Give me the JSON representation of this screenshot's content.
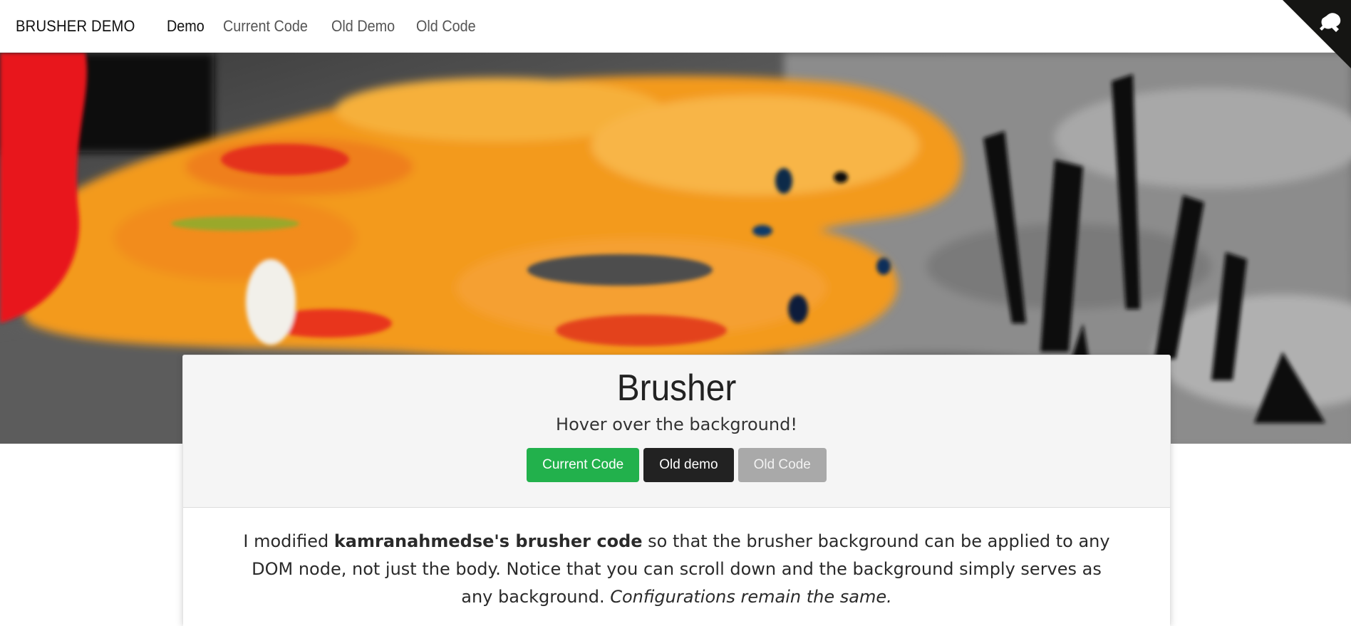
{
  "nav": {
    "brand": "BRUSHER DEMO",
    "links": [
      {
        "label": "Demo",
        "active": true
      },
      {
        "label": "Current Code",
        "active": false
      },
      {
        "label": "Old Demo",
        "active": false
      },
      {
        "label": "Old Code",
        "active": false
      }
    ]
  },
  "hero": {
    "title": "Brusher",
    "subtitle": "Hover over the background!",
    "buttons": [
      {
        "label": "Current Code",
        "color": "#22b14c"
      },
      {
        "label": "Old demo",
        "color": "#222222"
      },
      {
        "label": "Old Code",
        "color": "#a9a9a9"
      }
    ]
  },
  "body": {
    "text_pre": "I modified ",
    "text_bold": "kamranahmedse's brusher code",
    "text_mid": " so that the brusher background can be applied to any DOM node, not just the body. Notice that you can scroll down and the background simply serves as any background. ",
    "text_italic": "Configurations remain the same."
  },
  "icons": {
    "corner": "github-octocat-icon"
  }
}
